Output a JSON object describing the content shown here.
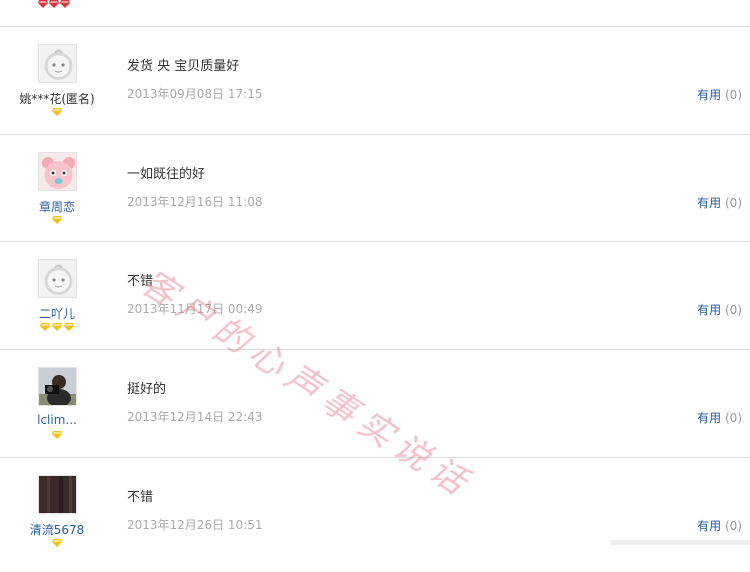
{
  "reviews": [
    {
      "username": "姚***花(匿名)",
      "comment": "发货 央 宝贝质量好",
      "date": "2013年09月08日 17:15",
      "useful_label": "有用",
      "useful_count": "(0)",
      "avatar": "default-face",
      "gems": 1,
      "username_color": "#333333"
    },
    {
      "username": "章周恋",
      "comment": "一如既往的好",
      "date": "2013年12月16日 11:08",
      "useful_label": "有用",
      "useful_count": "(0)",
      "avatar": "pink-bear",
      "gems": 1,
      "username_color": "#2a5d9f"
    },
    {
      "username": "二吖儿",
      "comment": "不错",
      "date": "2013年11月17日 00:49",
      "useful_label": "有用",
      "useful_count": "(0)",
      "avatar": "default-face",
      "gems": 3,
      "username_color": "#2a5d9f"
    },
    {
      "username": "lclim...",
      "comment": "挺好的",
      "date": "2013年12月14日 22:43",
      "useful_label": "有用",
      "useful_count": "(0)",
      "avatar": "photographer",
      "gems": 1,
      "username_color": "#2a5d9f"
    },
    {
      "username": "清流5678",
      "comment": "不错",
      "date": "2013年12月26日 10:51",
      "useful_label": "有用",
      "useful_count": "(0)",
      "avatar": "dark-photo",
      "gems": 1,
      "username_color": "#2a5d9f"
    }
  ],
  "top_gems": 3,
  "colors": {
    "gem_red": "#d9363e",
    "gem_yellow": "#f2c21a",
    "link_blue": "#2a5d9f"
  },
  "watermark": "客户的心声事实说话"
}
